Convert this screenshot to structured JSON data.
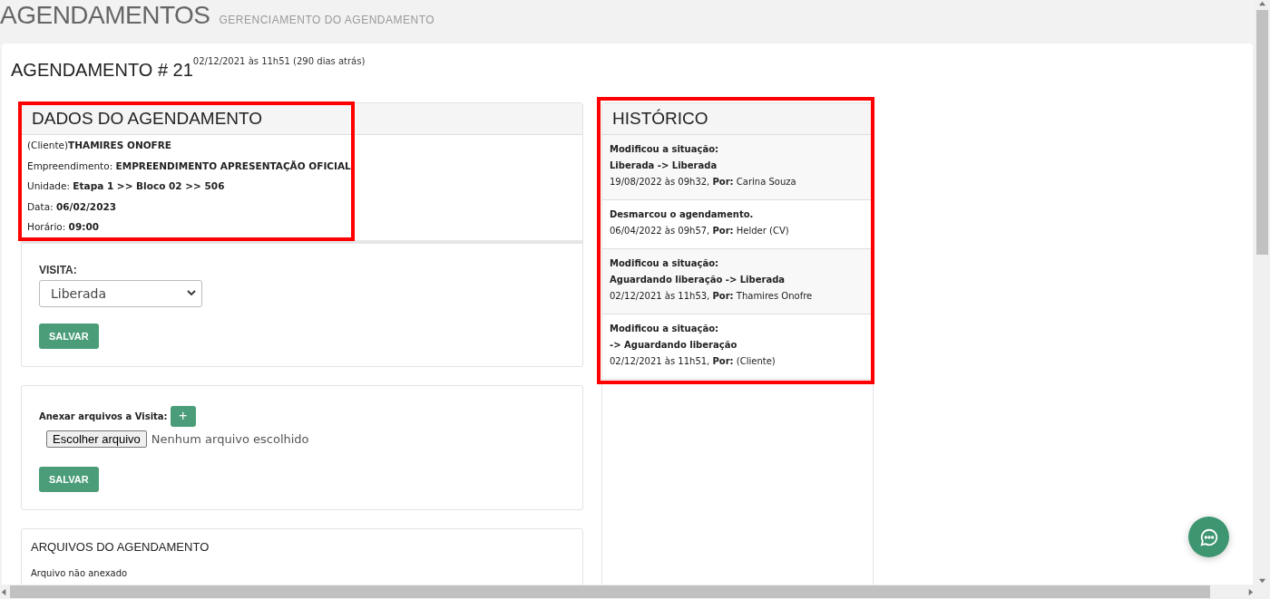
{
  "page": {
    "title": "AGENDAMENTOS",
    "subtitle": "GERENCIAMENTO DO AGENDAMENTO"
  },
  "record": {
    "title": "AGENDAMENTO # 21",
    "created": "02/12/2021 às 11h51 (290 dias atrás)"
  },
  "details": {
    "title": "DADOS DO AGENDAMENTO",
    "highlighted": true,
    "fields": [
      "(Cliente)**THAMIRES ONOFRE**",
      "Empreendimento: **EMPREENDIMENTO APRESENTAÇÃO OFICIAL**",
      "Unidade: **Etapa 1 >> Bloco 02 >> 506**",
      "Data: **06/02/2023**",
      "Horário: **09:00**"
    ]
  },
  "visit": {
    "label": "VISITA:",
    "value": "Liberada",
    "button": "SALVAR"
  },
  "attach": {
    "label": "Anexar arquivos a Visita:",
    "add_button": "+",
    "file_button": "Escolher arquivo",
    "file_status": "Nenhum arquivo escolhido",
    "button": "SALVAR"
  },
  "files": {
    "title": "ARQUIVOS DO AGENDAMENTO",
    "empty": "Arquivo não anexado"
  },
  "history": {
    "title": "HISTÓRICO",
    "highlighted": true,
    "entries": [
      {
        "lines": [
          "Modificou a situação:",
          "Liberada -> Liberada"
        ],
        "meta": "19/08/2022 às 09h32, **Por:** Carina Souza"
      },
      {
        "lines": [
          "Desmarcou o agendamento."
        ],
        "meta": "06/04/2022 às 09h57, **Por:** Helder (CV)"
      },
      {
        "lines": [
          "Modificou a situação:",
          "Aguardando liberação -> Liberada"
        ],
        "meta": "02/12/2021 às 11h53, **Por:** Thamires Onofre"
      },
      {
        "lines": [
          "Modificou a situação:",
          "-> Aguardando liberação"
        ],
        "meta": "02/12/2021 às 11h51, **Por:** (Cliente)"
      }
    ]
  }
}
